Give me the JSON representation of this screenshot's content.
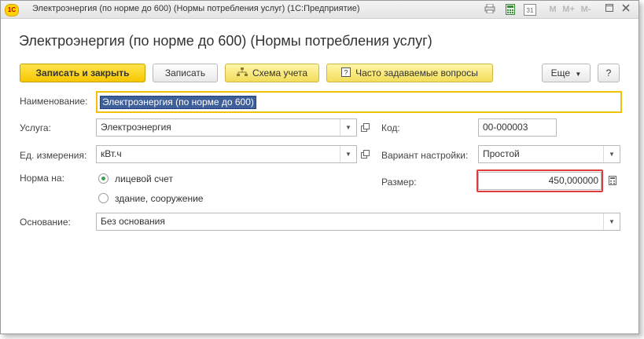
{
  "window": {
    "title": "Электроэнергия (по норме до 600) (Нормы потребления услуг)  (1С:Предприятие)",
    "logo": "1С",
    "toolbar_icons": [
      "printer-icon",
      "calculator-icon",
      "calendar-icon"
    ],
    "calendar_day": "31",
    "m_buttons": [
      "M",
      "M+",
      "M-"
    ]
  },
  "form": {
    "title": "Электроэнергия (по норме до 600) (Нормы потребления услуг)"
  },
  "toolbar": {
    "save_close": "Записать и закрыть",
    "save": "Записать",
    "scheme": "Схема учета",
    "faq": "Часто задаваемые вопросы",
    "more": "Еще",
    "help": "?"
  },
  "fields": {
    "name_label": "Наименование:",
    "name_value": "Электроэнергия (по норме до 600)",
    "service_label": "Услуга:",
    "service_value": "Электроэнергия",
    "code_label": "Код:",
    "code_value": "00-000003",
    "unit_label": "Ед. измерения:",
    "unit_value": "кВт.ч",
    "variant_label": "Вариант настройки:",
    "variant_value": "Простой",
    "norm_label": "Норма на:",
    "norm_options": [
      "лицевой счет",
      "здание, сооружение"
    ],
    "norm_selected": "лицевой счет",
    "size_label": "Размер:",
    "size_value": "450,000000",
    "basis_label": "Основание:",
    "basis_value": "Без основания"
  },
  "colors": {
    "primary_button": "#f7c700",
    "focus_border": "#f0c20a",
    "highlight_box": "#e03b3b",
    "selection": "#3e5f9a"
  }
}
